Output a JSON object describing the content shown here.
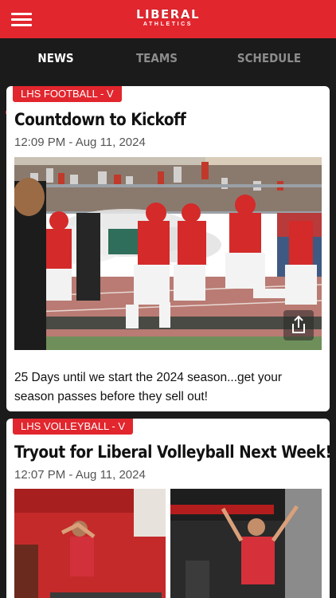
{
  "header": {
    "logo_main": "LIBERAL",
    "logo_sub": "ATHLETICS",
    "menu_icon": "hamburger-menu-icon"
  },
  "tabs": [
    {
      "label": "NEWS",
      "active": true
    },
    {
      "label": "TEAMS",
      "active": false
    },
    {
      "label": "SCHEDULE",
      "active": false
    }
  ],
  "colors": {
    "accent": "#e2262e",
    "tab_bar": "#1b1b1b",
    "inactive_tab": "#8c8c8c"
  },
  "feed": [
    {
      "badge": "LHS FOOTBALL - V",
      "title": "Countdown to Kickoff",
      "time": "12:09 PM - Aug 11, 2024",
      "body": "25 Days until we start the 2024 season...get your season passes before they sell out!",
      "share_icon": "share-icon"
    },
    {
      "badge": "LHS VOLLEYBALL - V",
      "title": "Tryout for Liberal Volleyball Next Week!",
      "time": "12:07 PM - Aug 11, 2024"
    }
  ]
}
